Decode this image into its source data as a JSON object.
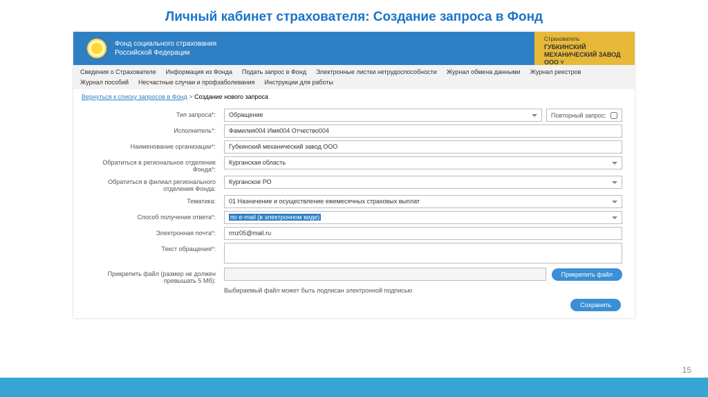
{
  "slide_title": "Личный кабинет страхователя: Создание запроса в Фонд",
  "header": {
    "org_line1": "Фонд социального страхования",
    "org_line2": "Российской Федерации"
  },
  "user": {
    "role": "Страхователь",
    "name": "ГУБКИНСКИЙ МЕХАНИЧЕСКИЙ ЗАВОД ООО ˅"
  },
  "nav": {
    "row1": [
      "Сведения о Страхователе",
      "Информация из Фонда",
      "Подать запрос в Фонд",
      "Электронные листки нетрудоспособности",
      "Журнал обмена данными",
      "Журнал реестров"
    ],
    "row2": [
      "Журнал пособий",
      "Несчастные случаи и профзаболевания",
      "Инструкции для работы"
    ]
  },
  "breadcrumb": {
    "link": "Вернуться к списку запросов в Фонд",
    "sep": ">",
    "current": "Создание нового запроса"
  },
  "form": {
    "type_label": "Тип запроса",
    "type_value": "Обращение",
    "repeat_label": "Повторный запрос:",
    "executor_label": "Исполнитель",
    "executor_value": "Фамилия004 Имя004 Отчество004",
    "org_label": "Наименование организации",
    "org_value": "Губкинский механический завод ООО",
    "region_label": "Обратиться в региональное отделение Фонда",
    "region_value": "Курганская область",
    "branch_label": "Обратиться в филиал регионального отделения Фонда:",
    "branch_value": "Курганское РО",
    "topic_label": "Тематика:",
    "topic_value": "01   Назначение и осуществление ежемесячных страховых выплат",
    "reply_label": "Способ получения ответа",
    "reply_value": "по e-mail (в электронном виде)",
    "email_label": "Электронная почта",
    "email_value": "rmz05@mail.ru",
    "text_label": "Текст обращения",
    "attach_label": "Прикрепить файл (размер не должен превышать 5 Мб):",
    "attach_btn": "Прикрепить файл",
    "hint": "Выбираемый файл может быть подписан электронной подписью",
    "save_btn": "Сохранить"
  },
  "page_num": "15"
}
